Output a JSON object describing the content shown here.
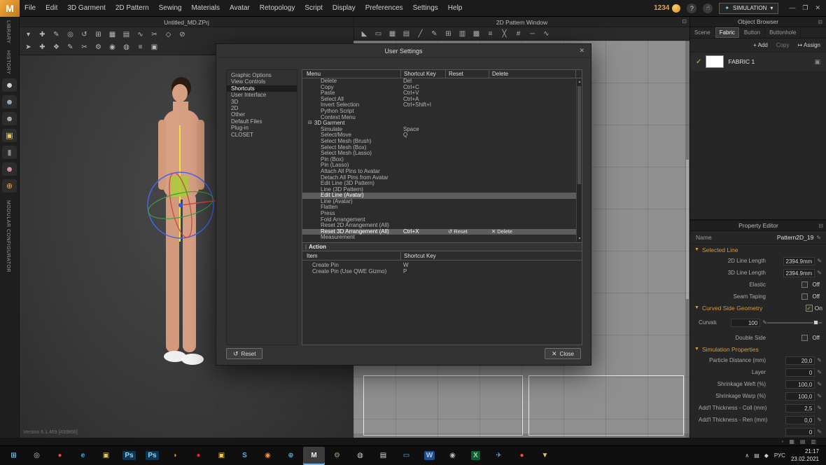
{
  "menubar": {
    "logo": "M",
    "items": [
      "File",
      "Edit",
      "3D Garment",
      "2D Pattern",
      "Sewing",
      "Materials",
      "Avatar",
      "Retopology",
      "Script",
      "Display",
      "Preferences",
      "Settings",
      "Help"
    ],
    "coins": "1234",
    "help_icon": "?",
    "hand_icon": "☝",
    "sim_icon": "✦",
    "simulation_label": "SIMULATION",
    "sim_caret": "▾",
    "win_min": "—",
    "win_max": "❐",
    "win_close": "✕"
  },
  "titlebar": {
    "project": "Untitled_MD.ZPrj",
    "pattern_window": "2D Pattern Window",
    "corner_icon": "⊡"
  },
  "left_strip": {
    "label_library": "LIBRARY",
    "label_history": "HISTORY",
    "label_modular": "MODULAR CONFIGURATOR",
    "icons": [
      {
        "name": "avatar-white-icon",
        "g": "☻",
        "c": "#e8e8e8"
      },
      {
        "name": "avatar-gray-icon",
        "g": "☻",
        "c": "#9fb6c9"
      },
      {
        "name": "avatar-dim-icon",
        "g": "☻",
        "c": "#b5b5b5"
      },
      {
        "name": "garment-folder-icon",
        "g": "▣",
        "c": "#e8c35a"
      },
      {
        "name": "fabric-icon",
        "g": "▮",
        "c": "#8a8a8a"
      },
      {
        "name": "avatar-pink-icon",
        "g": "☻",
        "c": "#e89ab0"
      },
      {
        "name": "globe-icon",
        "g": "⊕",
        "c": "#e8a33d"
      }
    ]
  },
  "toolbars": {
    "row1_3d": [
      {
        "g": "▾"
      },
      {
        "g": "✚"
      },
      {
        "g": "✎"
      },
      {
        "g": "◎"
      },
      {
        "g": "↺"
      },
      {
        "g": "⊞"
      },
      {
        "g": "▦"
      },
      {
        "g": "▤"
      },
      {
        "g": "∿"
      },
      {
        "g": "✂"
      },
      {
        "g": "◇"
      },
      {
        "g": "⊘"
      }
    ],
    "row2_3d": [
      {
        "g": "➤"
      },
      {
        "g": "✚"
      },
      {
        "g": "❖"
      },
      {
        "g": "✎"
      },
      {
        "g": "✂"
      },
      {
        "g": "⚙"
      },
      {
        "g": "◉"
      },
      {
        "g": "◍"
      },
      {
        "g": "≡"
      },
      {
        "g": "▣"
      }
    ],
    "row_2d": [
      {
        "g": "◣"
      },
      {
        "g": "▭"
      },
      {
        "g": "▦"
      },
      {
        "g": "▤"
      },
      {
        "g": "╱"
      },
      {
        "g": "✎"
      },
      {
        "g": "⊞"
      },
      {
        "g": "▥"
      },
      {
        "g": "▩"
      },
      {
        "g": "≡"
      },
      {
        "g": "╳"
      },
      {
        "g": "#"
      },
      {
        "g": "─"
      },
      {
        "g": "∿"
      }
    ]
  },
  "viewport": {
    "version": "Version 6.1.469 [438866]"
  },
  "object_browser": {
    "title": "Object Browser",
    "header_icon": "⊟",
    "tabs": [
      {
        "label": "Scene"
      },
      {
        "label": "Fabric",
        "active": true
      },
      {
        "label": "Button"
      },
      {
        "label": "Buttonhole"
      }
    ],
    "add_label": "+ Add",
    "copy_label": "Copy",
    "assign_label": "Assign",
    "assign_icon": "↦",
    "item_check": "✓",
    "item_name": "FABRIC 1",
    "item_icon": "▣"
  },
  "property_editor": {
    "title": "Property Editor",
    "header_icon": "⊟",
    "name_label": "Name",
    "name_value": "Pattern2D_19",
    "pencil_icon": "✎",
    "selected_line": {
      "header": "Selected Line",
      "rows": [
        {
          "label": "2D Line Length",
          "value": "2394.9mm",
          "pencil": true
        },
        {
          "label": "3D Line Length",
          "value": "2394.9mm",
          "pencil": true
        },
        {
          "label": "Elastic",
          "value": "Off",
          "check": true
        },
        {
          "label": "Seam Taping",
          "value": "Off",
          "check": true
        }
      ]
    },
    "curved_side": {
      "header": "Curved Side Geometry",
      "state_check": "✓",
      "state": "On",
      "rows": [
        {
          "label": "Curvature (%)",
          "value": "100",
          "pencil": true,
          "slider": true
        },
        {
          "label": "Double Side",
          "value": "Off",
          "check": true
        }
      ]
    },
    "simulation": {
      "header": "Simulation Properties",
      "rows": [
        {
          "label": "Particle Distance (mm)",
          "value": "20,0",
          "pencil": true
        },
        {
          "label": "Layer",
          "value": "0",
          "pencil": true
        },
        {
          "label": "Shrinkage Weft (%)",
          "value": "100,0",
          "pencil": true
        },
        {
          "label": "Shrinkage Warp (%)",
          "value": "100,0",
          "pencil": true
        },
        {
          "label": "Add'l Thickness - Coll (mm)",
          "value": "2,5",
          "pencil": true
        },
        {
          "label": "Add'l Thickness - Ren (mm)",
          "value": "0,0",
          "pencil": true
        },
        {
          "label": "",
          "value": "0",
          "pencil": true
        }
      ]
    }
  },
  "dialog": {
    "title": "User Settings",
    "close_icon": "✕",
    "categories": [
      {
        "label": "Graphic Options"
      },
      {
        "label": "View Controls"
      },
      {
        "label": "Shortcuts",
        "active": true
      },
      {
        "label": "User Interface"
      },
      {
        "label": "3D"
      },
      {
        "label": "2D"
      },
      {
        "label": "Other"
      },
      {
        "label": "Default Files"
      },
      {
        "label": "Plug-in"
      },
      {
        "label": "CLOSET"
      }
    ],
    "col_menu": "Menu",
    "col_key": "Shortcut Key",
    "col_reset": "Reset",
    "col_delete": "Delete",
    "group_glyph": "⊟",
    "rows": [
      {
        "label": "Delete",
        "key": "Del"
      },
      {
        "label": "Copy",
        "key": "Ctrl+C"
      },
      {
        "label": "Paste",
        "key": "Ctrl+V"
      },
      {
        "label": "Select All",
        "key": "Ctrl+A"
      },
      {
        "label": "Invert Selection",
        "key": "Ctrl+Shift+I"
      },
      {
        "label": "Python Script",
        "key": ""
      },
      {
        "label": "Context Menu",
        "key": ""
      },
      {
        "label": "3D Garment",
        "key": "",
        "group": true
      },
      {
        "label": "Simulate",
        "key": "Space"
      },
      {
        "label": "Select/Move",
        "key": "Q"
      },
      {
        "label": "Select Mesh (Brush)",
        "key": ""
      },
      {
        "label": "Select Mesh (Box)",
        "key": ""
      },
      {
        "label": "Select Mesh (Lasso)",
        "key": ""
      },
      {
        "label": "Pin (Box)",
        "key": ""
      },
      {
        "label": "Pin (Lasso)",
        "key": ""
      },
      {
        "label": "Attach All Pins to Avatar",
        "key": ""
      },
      {
        "label": "Detach All Pins from Avatar",
        "key": ""
      },
      {
        "label": "Edit Line (3D Pattern)",
        "key": ""
      },
      {
        "label": "Line (3D Pattern)",
        "key": ""
      },
      {
        "label": "Edit Line (Avatar)",
        "key": "",
        "selected": true
      },
      {
        "label": "Line (Avatar)",
        "key": ""
      },
      {
        "label": "Flatten",
        "key": ""
      },
      {
        "label": "Press",
        "key": ""
      },
      {
        "label": "Fold Arrangement",
        "key": ""
      },
      {
        "label": "Reset 2D Arrangement (All)",
        "key": ""
      },
      {
        "label": "Reset 3D Arrangement (All)",
        "key": "Ctrl+X",
        "selected": true,
        "buttons": true
      },
      {
        "label": "Measurement",
        "key": ""
      }
    ],
    "row_reset_icon": "↺",
    "row_reset_label": "Reset",
    "row_delete_icon": "✕",
    "row_delete_label": "Delete",
    "action_title": "Action",
    "act_col_item": "Item",
    "act_col_key": "Shortcut Key",
    "action_rows": [
      {
        "label": "Create Pin",
        "key": "W"
      },
      {
        "label": "Create Pin  (Use QWE Gizmo)",
        "key": "P"
      }
    ],
    "reset_button": "Reset",
    "reset_button_icon": "↺",
    "close_button": "Close",
    "close_button_icon": "✕"
  },
  "bottom_strip": {
    "icons": [
      {
        "g": "▫"
      },
      {
        "g": "▦"
      },
      {
        "g": "▤"
      },
      {
        "g": "▥"
      }
    ]
  },
  "taskbar": {
    "icons": [
      {
        "name": "start-icon",
        "g": "⊞",
        "fg": "#7fc9f0"
      },
      {
        "name": "search-icon",
        "g": "◎",
        "fg": "#cccccc"
      },
      {
        "name": "chrome-icon",
        "g": "●",
        "fg": "#e8453c"
      },
      {
        "name": "edge-icon",
        "g": "e",
        "fg": "#38b6e0"
      },
      {
        "name": "folder-icon",
        "g": "▣",
        "fg": "#e9c458"
      },
      {
        "name": "photoshop-icon",
        "g": "Ps",
        "fg": "#8fd0f5",
        "bg": "#0c3653"
      },
      {
        "name": "photoshop-icon",
        "g": "Ps",
        "fg": "#8fd0f5",
        "bg": "#0c3653"
      },
      {
        "name": "firefox-icon",
        "g": "◗",
        "fg": "#ff9124"
      },
      {
        "name": "opera-icon",
        "g": "●",
        "fg": "#ff1b2d"
      },
      {
        "name": "folder-icon",
        "g": "▣",
        "fg": "#e9c458"
      },
      {
        "name": "skype-icon",
        "g": "S",
        "fg": "#45b6e6"
      },
      {
        "name": "pin-icon",
        "g": "◉",
        "fg": "#ff8a3c"
      },
      {
        "name": "globe-icon",
        "g": "⊕",
        "fg": "#46b3d6"
      },
      {
        "name": "marvelous-designer-icon",
        "g": "M",
        "fg": "#f0f0f0",
        "active": true
      },
      {
        "name": "gear-icon",
        "g": "⚙",
        "fg": "#c09a62"
      },
      {
        "name": "browser-icon",
        "g": "◍",
        "fg": "#cfcfcf"
      },
      {
        "name": "notepad-icon",
        "g": "▤",
        "fg": "#d8d8d8"
      },
      {
        "name": "monitor-icon",
        "g": "▭",
        "fg": "#5aa7e8"
      },
      {
        "name": "word-icon",
        "g": "W",
        "fg": "#a8c8f0",
        "bg": "#1e4e8c"
      },
      {
        "name": "obs-icon",
        "g": "◉",
        "fg": "#b9b9b9"
      },
      {
        "name": "excel-icon",
        "g": "X",
        "fg": "#9ad8ae",
        "bg": "#0e5c30"
      },
      {
        "name": "telegram-icon",
        "g": "✈",
        "fg": "#54a9dd"
      },
      {
        "name": "opera-red-icon",
        "g": "●",
        "fg": "#ff4b3c"
      },
      {
        "name": "download-icon",
        "g": "▼",
        "fg": "#e9c458"
      }
    ],
    "tray_icons": [
      {
        "g": "∧"
      },
      {
        "g": "▤"
      },
      {
        "g": "◆"
      }
    ],
    "lang": "РУС",
    "time": "21:17",
    "date": "23.02.2021"
  }
}
